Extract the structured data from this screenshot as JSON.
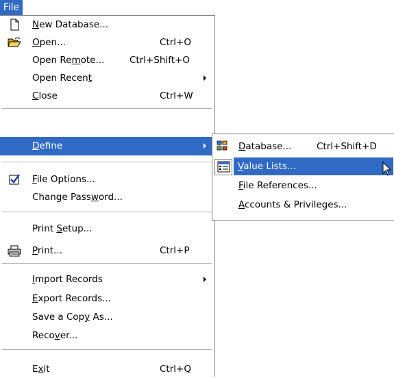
{
  "menubar": {
    "file_label": "File"
  },
  "file_menu": {
    "new_db": {
      "pre": "",
      "u": "N",
      "post": "ew Database...",
      "shortcut": ""
    },
    "open": {
      "pre": "",
      "u": "O",
      "post": "pen...",
      "shortcut": "Ctrl+O"
    },
    "open_remote": {
      "pre": "Open Re",
      "u": "m",
      "post": "ote...",
      "shortcut": "Ctrl+Shift+O"
    },
    "open_recent": {
      "pre": "Open Recen",
      "u": "t",
      "post": "",
      "shortcut": ""
    },
    "close": {
      "pre": "",
      "u": "C",
      "post": "lose",
      "shortcut": "Ctrl+W"
    },
    "define": {
      "pre": "",
      "u": "D",
      "post": "efine",
      "shortcut": ""
    },
    "file_options": {
      "pre": "",
      "u": "F",
      "post": "ile Options...",
      "shortcut": ""
    },
    "change_password": {
      "pre": "Change Pass",
      "u": "w",
      "post": "ord...",
      "shortcut": ""
    },
    "print_setup": {
      "pre": "Print ",
      "u": "S",
      "post": "etup...",
      "shortcut": ""
    },
    "print": {
      "pre": "",
      "u": "P",
      "post": "rint...",
      "shortcut": "Ctrl+P"
    },
    "import_records": {
      "pre": "",
      "u": "I",
      "post": "mport Records",
      "shortcut": ""
    },
    "export_records": {
      "pre": "",
      "u": "E",
      "post": "xport Records...",
      "shortcut": ""
    },
    "save_copy": {
      "pre": "Save a Cop",
      "u": "y",
      "post": " As...",
      "shortcut": ""
    },
    "recover": {
      "pre": "Reco",
      "u": "v",
      "post": "er...",
      "shortcut": ""
    },
    "exit": {
      "pre": "E",
      "u": "x",
      "post": "it",
      "shortcut": "Ctrl+Q"
    }
  },
  "define_submenu": {
    "database": {
      "pre": "",
      "u": "D",
      "post": "atabase...",
      "shortcut": "Ctrl+Shift+D"
    },
    "value_lists": {
      "pre": "",
      "u": "V",
      "post": "alue Lists...",
      "shortcut": ""
    },
    "file_references": {
      "pre": "",
      "u": "F",
      "post": "ile References...",
      "shortcut": ""
    },
    "accounts": {
      "pre": "",
      "u": "A",
      "post": "ccounts & Privileges...",
      "shortcut": ""
    }
  },
  "colors": {
    "highlight": "#316ac5",
    "separator": "#b0b0b0"
  }
}
